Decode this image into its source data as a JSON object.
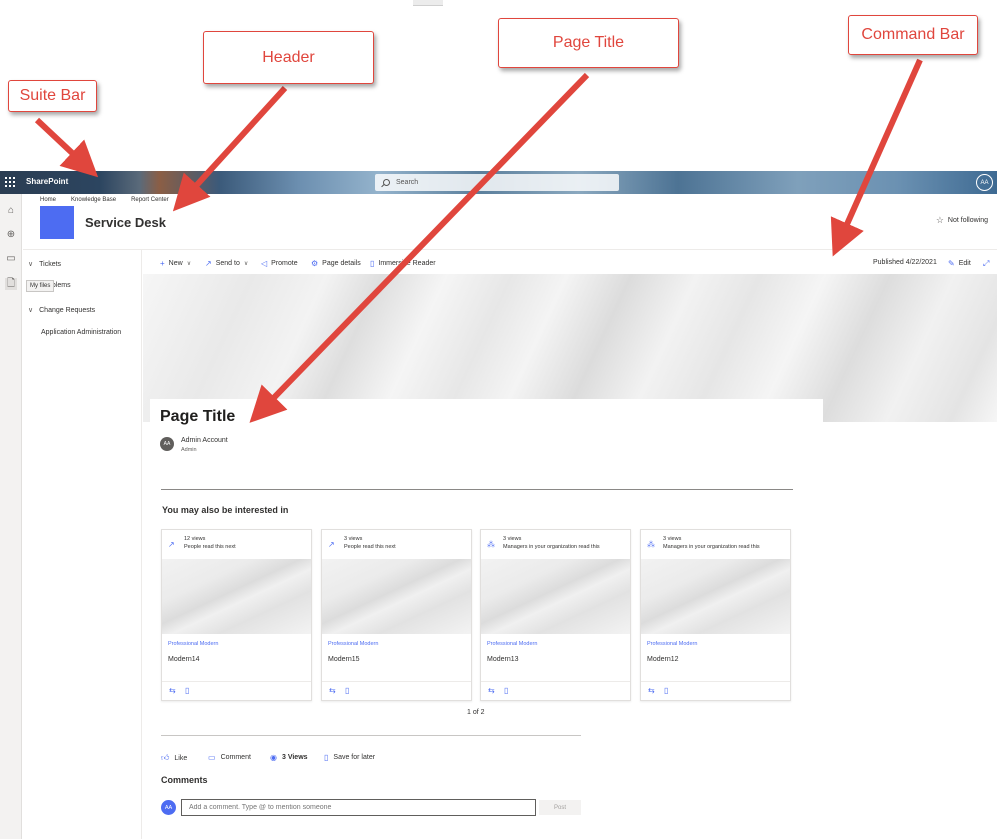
{
  "callouts": {
    "suite_bar": "Suite Bar",
    "header": "Header",
    "page_title": "Page Title",
    "command_bar": "Command Bar"
  },
  "suitebar": {
    "brand": "SharePoint",
    "search_placeholder": "Search",
    "avatar": "AA"
  },
  "rail": {
    "tooltip": "My files"
  },
  "header": {
    "nav": [
      "Home",
      "Knowledge Base",
      "Report Center"
    ],
    "site_title": "Service Desk",
    "follow_label": "Not following",
    "logo_color": "#4d6cf2"
  },
  "leftnav": {
    "items": [
      "Tickets",
      "Problems",
      "Change Requests",
      "Application Administration"
    ]
  },
  "commandbar": {
    "new": "New",
    "send_to": "Send to",
    "promote": "Promote",
    "page_details": "Page details",
    "immersive_reader": "Immersive Reader",
    "published": "Published 4/22/2021",
    "edit": "Edit"
  },
  "page": {
    "title": "Page Title",
    "author": {
      "initials": "AA",
      "name": "Admin Account",
      "role": "Admin"
    },
    "section_heading": "You may also be interested in",
    "cards": [
      {
        "views": "12 views",
        "reason": "People read this next",
        "site": "Professional Modern",
        "name": "Modern14",
        "icon": "trending-icon"
      },
      {
        "views": "3 views",
        "reason": "People read this next",
        "site": "Professional Modern",
        "name": "Modern15",
        "icon": "trending-icon"
      },
      {
        "views": "3 views",
        "reason": "Managers in your organization read this",
        "site": "Professional Modern",
        "name": "Modern13",
        "icon": "org-icon"
      },
      {
        "views": "3 views",
        "reason": "Managers in your organization read this",
        "site": "Professional Modern",
        "name": "Modern12",
        "icon": "org-icon"
      }
    ],
    "pager": "1 of 2"
  },
  "social": {
    "like": "Like",
    "comment": "Comment",
    "views": "3 Views",
    "save": "Save for later"
  },
  "comments": {
    "heading": "Comments",
    "avatar": "AA",
    "placeholder": "Add a comment. Type @ to mention someone",
    "post": "Post"
  },
  "colors": {
    "accent": "#4d6cf2",
    "callout": "#e0463d"
  }
}
